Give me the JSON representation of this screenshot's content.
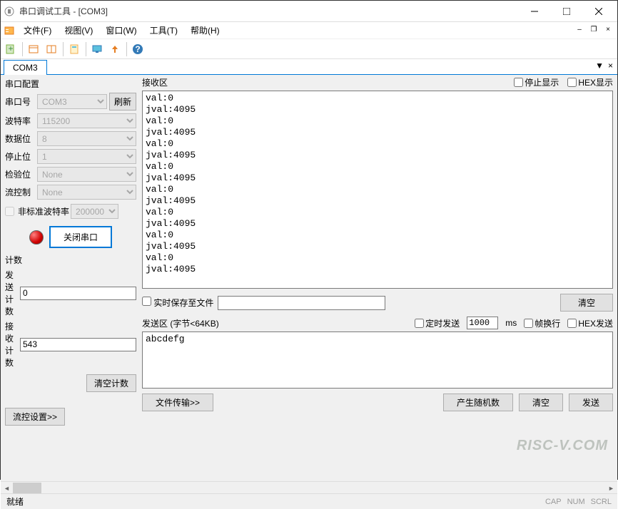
{
  "window": {
    "title": "串口调试工具 - [COM3]"
  },
  "menus": {
    "file": "文件(F)",
    "view": "视图(V)",
    "window": "窗口(W)",
    "tools": "工具(T)",
    "help": "帮助(H)"
  },
  "tab": {
    "label": "COM3"
  },
  "config": {
    "group_title": "串口配置",
    "port_label": "串口号",
    "port_value": "COM3",
    "refresh_btn": "刷新",
    "baud_label": "波特率",
    "baud_value": "115200",
    "data_label": "数据位",
    "data_value": "8",
    "stop_label": "停止位",
    "stop_value": "1",
    "parity_label": "检验位",
    "parity_value": "None",
    "flow_label": "流控制",
    "flow_value": "None",
    "nonstd_label": "非标准波特率",
    "nonstd_value": "200000",
    "close_port_btn": "关闭串口"
  },
  "counts": {
    "group_title": "计数",
    "send_label": "发送计数",
    "send_value": "0",
    "recv_label": "接收计数",
    "recv_value": "543",
    "clear_btn": "清空计数"
  },
  "flow_settings_btn": "流控设置>>",
  "rx": {
    "title": "接收区",
    "stop_display": "停止显示",
    "hex_display": "HEX显示",
    "content": "val:0\njval:4095\nval:0\njval:4095\nval:0\njval:4095\nval:0\njval:4095\nval:0\njval:4095\nval:0\njval:4095\nval:0\njval:4095\nval:0\njval:4095",
    "save_realtime": "实时保存至文件",
    "clear_btn": "清空"
  },
  "tx": {
    "title": "发送区 (字节<64KB)",
    "timed_send": "定时发送",
    "interval": "1000",
    "ms": "ms",
    "wrap": "帧换行",
    "hex_send": "HEX发送",
    "content": "abcdefg",
    "file_transfer_btn": "文件传输>>",
    "random_btn": "产生随机数",
    "clear_btn": "清空",
    "send_btn": "发送"
  },
  "status": {
    "ready": "就绪",
    "cap": "CAP",
    "num": "NUM",
    "scrl": "SCRL"
  },
  "watermark": "RISC-V.COM"
}
